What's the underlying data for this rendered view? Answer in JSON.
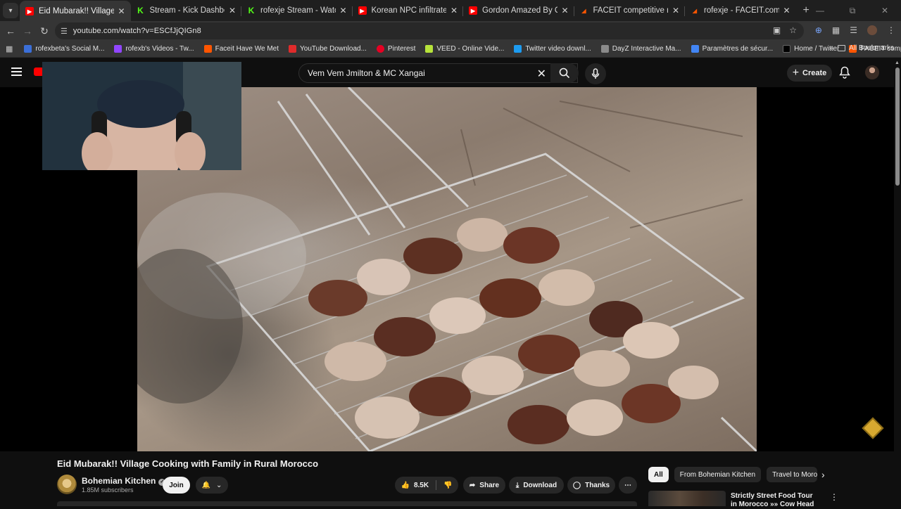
{
  "browser": {
    "tabs": [
      {
        "title": "Eid Mubarak!! Village Cooking w",
        "icon": "youtube-icon",
        "active": true
      },
      {
        "title": "Stream - Kick Dashboard",
        "icon": "kick-icon",
        "active": false
      },
      {
        "title": "rofexje Stream - Watch Live on",
        "icon": "kick-icon",
        "active": false
      },
      {
        "title": "Korean NPC infiltrates Sony HQ",
        "icon": "youtube-icon",
        "active": false
      },
      {
        "title": "Gordon Amazed By Chef Who Ha",
        "icon": "youtube-icon",
        "active": false
      },
      {
        "title": "FACEIT competitive match - FACE",
        "icon": "faceit-icon",
        "active": false
      },
      {
        "title": "rofexje - FACEIT.com",
        "icon": "faceit-icon",
        "active": false
      }
    ],
    "url": "youtube.com/watch?v=ESCfJjQIGn8",
    "bookmarks": [
      {
        "label": "rofexbeta's Social M...",
        "icon": "social-icon",
        "color": "#3b6fd8"
      },
      {
        "label": "rofexb's Videos - Tw...",
        "icon": "twitch-icon",
        "color": "#9146ff"
      },
      {
        "label": "Faceit Have We Met",
        "icon": "faceit-icon",
        "color": "#ff5500"
      },
      {
        "label": "YouTube Download...",
        "icon": "download-icon",
        "color": "#e02b2b"
      },
      {
        "label": "Pinterest",
        "icon": "pinterest-icon",
        "color": "#e60023"
      },
      {
        "label": "VEED - Online Vide...",
        "icon": "veed-icon",
        "color": "#b7e33b"
      },
      {
        "label": "Twitter video downl...",
        "icon": "twitter-dl-icon",
        "color": "#1d9bf0"
      },
      {
        "label": "DayZ Interactive Ma...",
        "icon": "dayz-icon",
        "color": "#8a8a8a"
      },
      {
        "label": "Paramètres de sécur...",
        "icon": "google-icon",
        "color": "#4285f4"
      },
      {
        "label": "Home / Twitter",
        "icon": "x-icon",
        "color": "#000000"
      },
      {
        "label": "FACEIT competitive...",
        "icon": "faceit-icon",
        "color": "#ff5500"
      }
    ],
    "all_bookmarks_label": "All Bookmarks"
  },
  "youtube": {
    "search_query": "Vem Vem Jmilton & MC Xangai",
    "create_label": "Create",
    "video": {
      "title": "Eid Mubarak!! Village Cooking with Family in Rural Morocco",
      "channel": "Bohemian Kitchen",
      "subscribers": "1.85M subscribers",
      "join_label": "Join",
      "likes": "8.5K",
      "share_label": "Share",
      "download_label": "Download",
      "thanks_label": "Thanks"
    },
    "chips": [
      "All",
      "From Bohemian Kitchen",
      "Travel to Morocco"
    ],
    "recommendation": {
      "title": "Strictly Street Food Tour in Morocco »» Cow Head"
    }
  },
  "colors": {
    "accent": "#ff0000",
    "background": "#0f0f0f",
    "surface": "#272727"
  }
}
